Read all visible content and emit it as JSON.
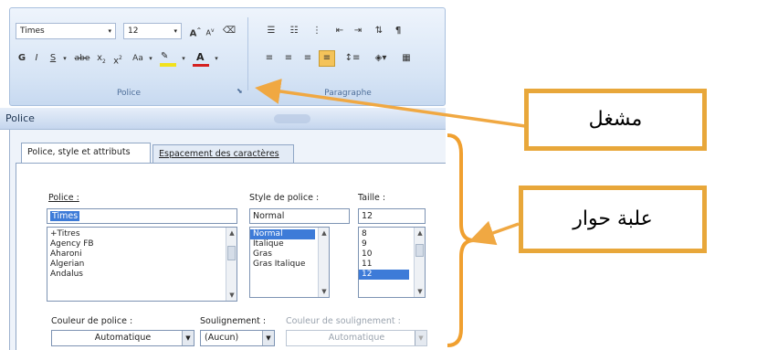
{
  "ribbon": {
    "font_name": "Times",
    "font_size": "12",
    "grow_label": "A",
    "shrink_label": "A",
    "bold_label": "G",
    "italic_label": "I",
    "underline_label": "S",
    "strike_label": "abe",
    "subscript_label": "x",
    "superscript_label": "x",
    "case_label": "Aa",
    "group_police_label": "Police",
    "group_paragraphe_label": "Paragraphe"
  },
  "dialog": {
    "title": "Police",
    "tabs": [
      {
        "label": "Police, style et attributs"
      },
      {
        "label": "Espacement des caractères"
      }
    ],
    "font_label": "Police :",
    "font_value": "Times",
    "font_list": [
      "+Titres",
      "Agency FB",
      "Aharoni",
      "Algerian",
      "Andalus"
    ],
    "style_label": "Style de police :",
    "style_value": "Normal",
    "style_list": [
      "Normal",
      "Italique",
      "Gras",
      "Gras Italique"
    ],
    "size_label": "Taille :",
    "size_value": "12",
    "size_list": [
      "8",
      "9",
      "10",
      "11",
      "12"
    ],
    "color_label": "Couleur de police :",
    "color_value": "Automatique",
    "underline_label": "Soulignement :",
    "underline_value": "(Aucun)",
    "underline_color_label": "Couleur de soulignement :",
    "underline_color_value": "Automatique"
  },
  "annotations": {
    "launcher_label": "مشغل",
    "dialog_label": "علبة حوار"
  },
  "colors": {
    "callout_border": "#e8a73a",
    "arrow": "#f0a842",
    "brace": "#f0a030",
    "highlight_yellow": "#f2e21c",
    "font_red": "#d42020",
    "selection_blue": "#3d7bd8"
  }
}
